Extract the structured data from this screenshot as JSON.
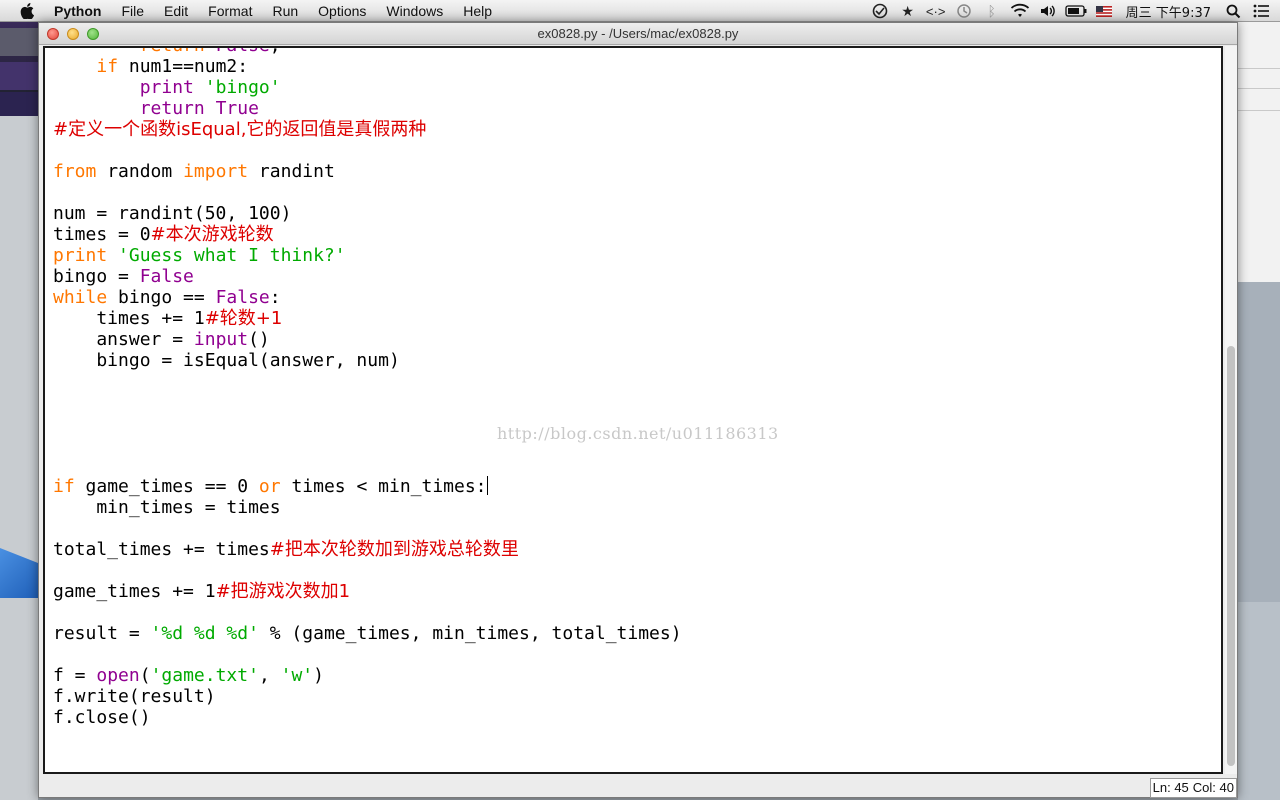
{
  "menubar": {
    "app_name": "Python",
    "items": [
      "File",
      "Edit",
      "Format",
      "Run",
      "Options",
      "Windows",
      "Help"
    ],
    "clock": "周三 下午9:37"
  },
  "window": {
    "title": "ex0828.py - /Users/mac/ex0828.py"
  },
  "editor": {
    "lines": [
      [
        {
          "t": "        "
        },
        {
          "t": "return",
          "c": "kw"
        },
        {
          "t": " "
        },
        {
          "t": "False",
          "c": "bi"
        },
        {
          "t": ","
        }
      ],
      [
        {
          "t": "    "
        },
        {
          "t": "if",
          "c": "kw"
        },
        {
          "t": " num1==num2:"
        }
      ],
      [
        {
          "t": "        "
        },
        {
          "t": "print",
          "c": "bi"
        },
        {
          "t": " "
        },
        {
          "t": "'bingo'",
          "c": "str"
        }
      ],
      [
        {
          "t": "        "
        },
        {
          "t": "return",
          "c": "bi"
        },
        {
          "t": " "
        },
        {
          "t": "True",
          "c": "bi"
        }
      ],
      [
        {
          "t": "#定义一个函数isEqual,它的返回值是真假两种",
          "c": "com"
        }
      ],
      [],
      [
        {
          "t": "from",
          "c": "kw"
        },
        {
          "t": " random "
        },
        {
          "t": "import",
          "c": "kw"
        },
        {
          "t": " randint"
        }
      ],
      [],
      [
        {
          "t": "num = randint(50, 100)"
        }
      ],
      [
        {
          "t": "times = 0"
        },
        {
          "t": "#本次游戏轮数",
          "c": "com"
        }
      ],
      [
        {
          "t": "print",
          "c": "kw"
        },
        {
          "t": " "
        },
        {
          "t": "'Guess what I think?'",
          "c": "str"
        }
      ],
      [
        {
          "t": "bingo = "
        },
        {
          "t": "False",
          "c": "bi"
        }
      ],
      [
        {
          "t": "while",
          "c": "kw"
        },
        {
          "t": " bingo == "
        },
        {
          "t": "False",
          "c": "bi"
        },
        {
          "t": ":"
        }
      ],
      [
        {
          "t": "    times += 1"
        },
        {
          "t": "#轮数+1",
          "c": "com"
        }
      ],
      [
        {
          "t": "    answer = "
        },
        {
          "t": "input",
          "c": "bi"
        },
        {
          "t": "()"
        }
      ],
      [
        {
          "t": "    bingo = isEqual(answer, num)"
        }
      ],
      [],
      [],
      [],
      [],
      [],
      [
        {
          "t": "if",
          "c": "kw"
        },
        {
          "t": " game_times == 0 "
        },
        {
          "t": "or",
          "c": "kw"
        },
        {
          "t": " times < min_times:"
        },
        {
          "cursor": true
        }
      ],
      [
        {
          "t": "    min_times = times"
        }
      ],
      [],
      [
        {
          "t": "total_times += times"
        },
        {
          "t": "#把本次轮数加到游戏总轮数里",
          "c": "com"
        }
      ],
      [],
      [
        {
          "t": "game_times += 1"
        },
        {
          "t": "#把游戏次数加1",
          "c": "com"
        }
      ],
      [],
      [
        {
          "t": "result = "
        },
        {
          "t": "'%d %d %d'",
          "c": "str"
        },
        {
          "t": " % (game_times, min_times, total_times)"
        }
      ],
      [],
      [
        {
          "t": "f = "
        },
        {
          "t": "open",
          "c": "bi"
        },
        {
          "t": "("
        },
        {
          "t": "'game.txt'",
          "c": "str"
        },
        {
          "t": ", "
        },
        {
          "t": "'w'",
          "c": "str"
        },
        {
          "t": ")"
        }
      ],
      [
        {
          "t": "f.write(result)"
        }
      ],
      [
        {
          "t": "f.close()"
        }
      ]
    ],
    "watermark": "http://blog.csdn.net/u011186313"
  },
  "statusbar": {
    "ln": "Ln: 45",
    "col": "Col: 40"
  }
}
